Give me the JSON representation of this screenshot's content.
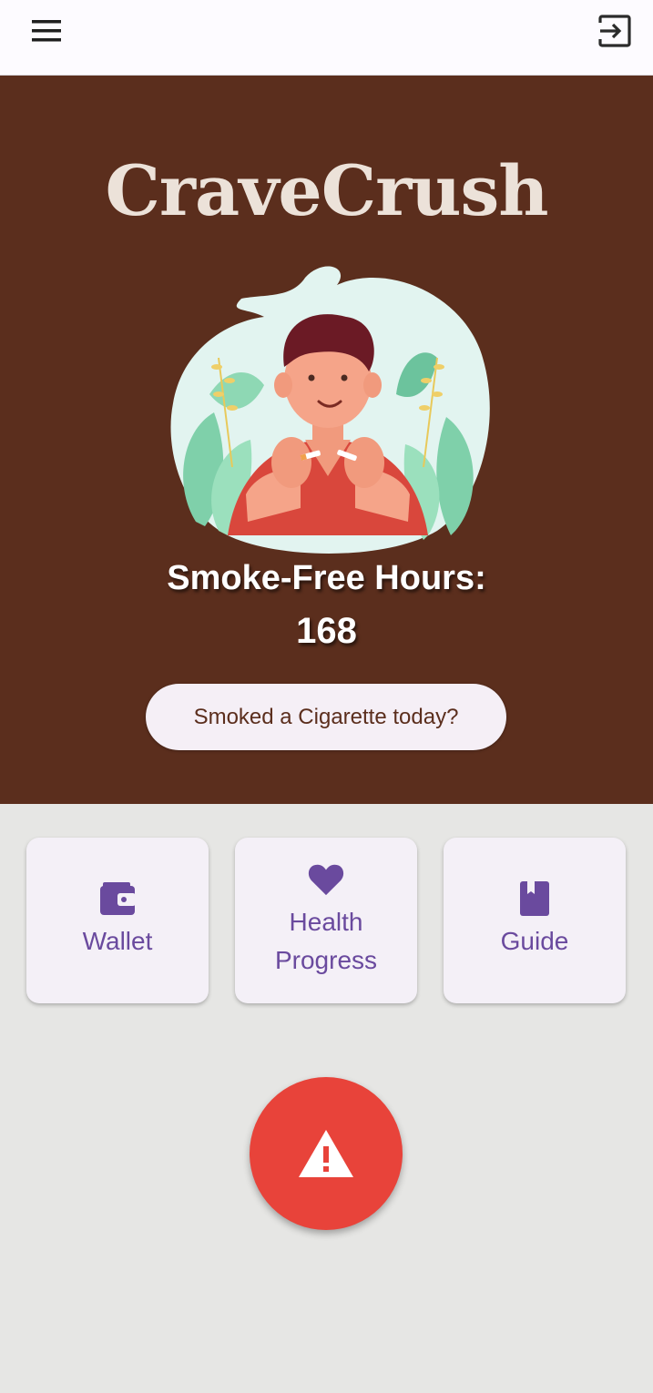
{
  "app_bar": {
    "menu_icon": "menu-icon",
    "logout_icon": "logout-icon"
  },
  "hero": {
    "title": "CraveCrush",
    "hours_label": "Smoke-Free Hours:",
    "hours_value": "168",
    "smoked_button": "Smoked a Cigarette today?"
  },
  "cards": [
    {
      "label": "Wallet",
      "icon": "wallet-icon"
    },
    {
      "label": "Health Progress",
      "icon": "heart-icon"
    },
    {
      "label": "Guide",
      "icon": "book-icon"
    }
  ],
  "sos": {
    "icon": "warning-icon"
  },
  "colors": {
    "hero_background": "#5b2e1d",
    "accent_purple": "#6a4a9e",
    "alert_red": "#e8433a",
    "page_background": "#e6e6e4"
  }
}
